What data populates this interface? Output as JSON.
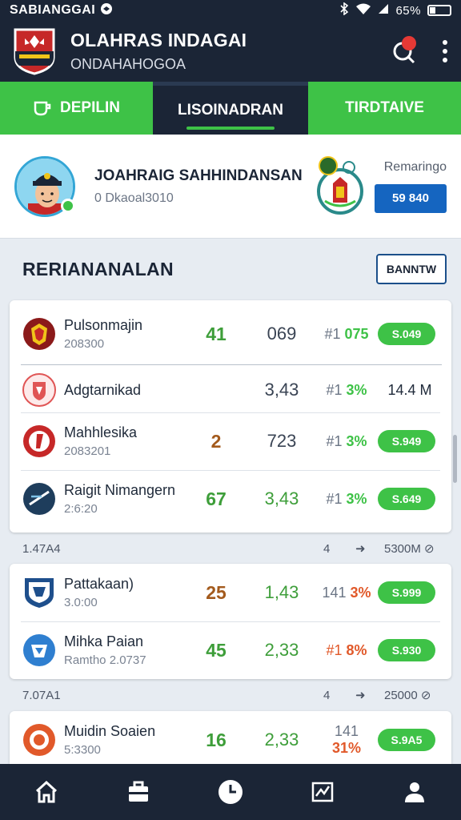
{
  "status_bar": {
    "left_text": "SABIANGGAI",
    "battery": "65%"
  },
  "header": {
    "title": "OLAHRAS INDAGAI",
    "subtitle": "ONDAHAHOGOA"
  },
  "tabs": [
    {
      "label": "DEPILIN",
      "icon": "cup-icon"
    },
    {
      "label": "LISOINADRAN",
      "active": true
    },
    {
      "label": "TIRDTAIVE"
    }
  ],
  "profile": {
    "name": "JOAHRAIG SAHHINDANSAN",
    "sub": "0 Dkaoal3010",
    "right_label": "Remaringo",
    "button": "59 840"
  },
  "section": {
    "title": "RERIANANALAN",
    "button": "BANNTW"
  },
  "group1": {
    "rows": [
      {
        "name": "Pulsonmajin",
        "sub": "208300",
        "a": "41",
        "b": "069",
        "c_pre": "#1",
        "c_val": "075",
        "pill": "S.049"
      },
      {
        "name": "Adgtarnikad",
        "sub": "",
        "a": "",
        "b": "3,43",
        "c_pre": "#1",
        "c_val": "3%",
        "plain": "14.4 M"
      },
      {
        "name": "Mahhlesika",
        "sub": "2083201",
        "a": "2",
        "b": "723",
        "c_pre": "#1",
        "c_val": "3%",
        "pill": "S.949"
      },
      {
        "name": "Raigit Nimangern",
        "sub": "2:6:20",
        "a": "67",
        "b": "3,43",
        "c_pre": "#1",
        "c_val": "3%",
        "pill": "S.649"
      }
    ]
  },
  "group2_head": {
    "left": "1.47A4",
    "mid": "4",
    "right": "5300M"
  },
  "group2": {
    "rows": [
      {
        "name": "Pattakaan)",
        "sub": "3.0:00",
        "a": "25",
        "b": "1,43",
        "c_pre": "141",
        "c_val": "3%",
        "pill": "S.999"
      },
      {
        "name": "Mihka Paian",
        "sub": "Ramtho 2.0737",
        "a": "45",
        "b": "2,33",
        "c_pre": "#1",
        "c_val": "8%",
        "pill": "S.930"
      }
    ]
  },
  "group3_head": {
    "left": "7.07A1",
    "mid": "4",
    "right": "25000"
  },
  "group3": {
    "rows": [
      {
        "name": "Muidin Soaien",
        "sub": "5:3300",
        "a": "16",
        "b": "2,33",
        "c_pre": "141",
        "c_val": "31%",
        "pill": "S.9A5"
      }
    ]
  },
  "nav": [
    "home-icon",
    "briefcase-icon",
    "clock-icon",
    "chart-icon",
    "profile-icon"
  ]
}
